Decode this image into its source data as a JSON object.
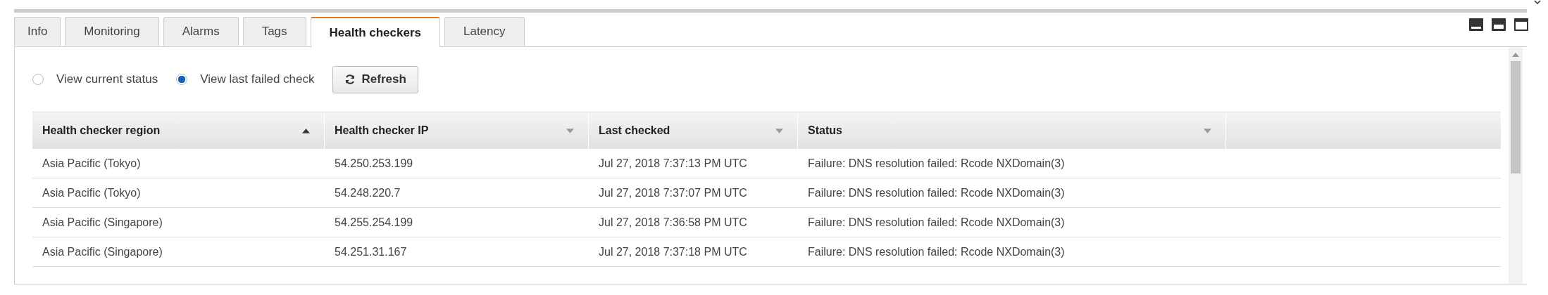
{
  "tabs": [
    {
      "label": "Info",
      "selected": false
    },
    {
      "label": "Monitoring",
      "selected": false
    },
    {
      "label": "Alarms",
      "selected": false
    },
    {
      "label": "Tags",
      "selected": false
    },
    {
      "label": "Health checkers",
      "selected": true
    },
    {
      "label": "Latency",
      "selected": false
    }
  ],
  "view_options": [
    {
      "label": "View current status",
      "selected": false
    },
    {
      "label": "View last failed check",
      "selected": true
    }
  ],
  "refresh_button": {
    "label": "Refresh"
  },
  "table": {
    "columns": [
      {
        "label": "Health checker region",
        "sorted": true
      },
      {
        "label": "Health checker IP",
        "sorted": false
      },
      {
        "label": "Last checked",
        "sorted": false
      },
      {
        "label": "Status",
        "sorted": false
      }
    ],
    "rows": [
      [
        "Asia Pacific (Tokyo)",
        "54.250.253.199",
        "Jul 27, 2018 7:37:13 PM UTC",
        "Failure: DNS resolution failed: Rcode NXDomain(3)"
      ],
      [
        "Asia Pacific (Tokyo)",
        "54.248.220.7",
        "Jul 27, 2018 7:37:07 PM UTC",
        "Failure: DNS resolution failed: Rcode NXDomain(3)"
      ],
      [
        "Asia Pacific (Singapore)",
        "54.255.254.199",
        "Jul 27, 2018 7:36:58 PM UTC",
        "Failure: DNS resolution failed: Rcode NXDomain(3)"
      ],
      [
        "Asia Pacific (Singapore)",
        "54.251.31.167",
        "Jul 27, 2018 7:37:18 PM UTC",
        "Failure: DNS resolution failed: Rcode NXDomain(3)"
      ]
    ]
  }
}
